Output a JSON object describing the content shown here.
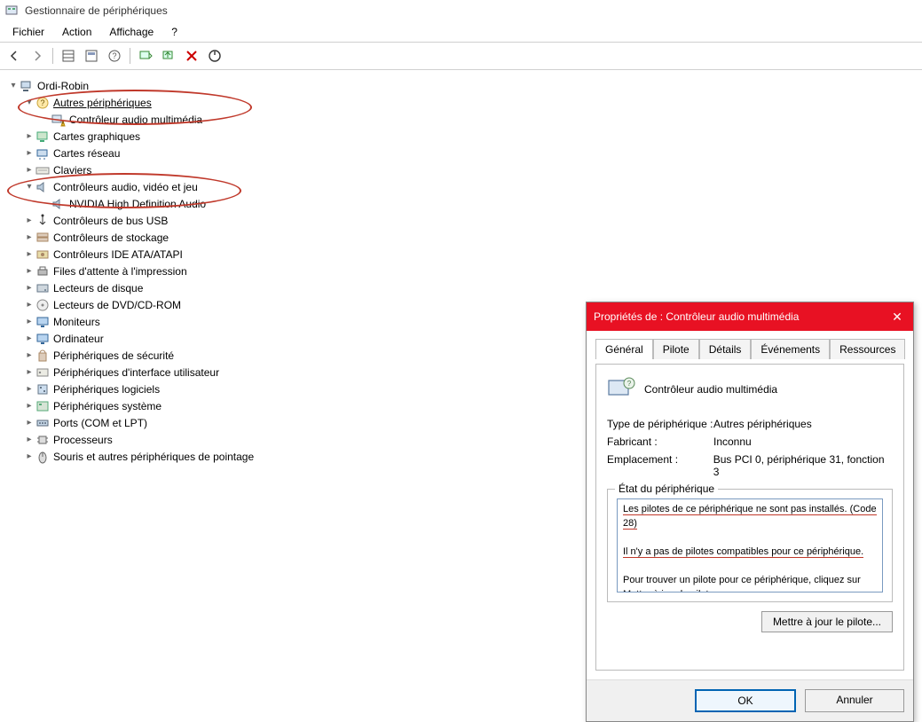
{
  "window_title": "Gestionnaire de périphériques",
  "menu": {
    "file": "Fichier",
    "action": "Action",
    "view": "Affichage",
    "help": "?"
  },
  "tree": {
    "root": "Ordi-Robin",
    "other_devices": "Autres périphériques",
    "mm_audio_controller": "Contrôleur audio multimédia",
    "graphics": "Cartes graphiques",
    "network": "Cartes réseau",
    "keyboards": "Claviers",
    "avj": "Contrôleurs audio, vidéo et jeu",
    "nvidia_hd": "NVIDIA High Definition Audio",
    "usb": "Contrôleurs de bus USB",
    "storage": "Contrôleurs de stockage",
    "ide": "Contrôleurs IDE ATA/ATAPI",
    "print_queue": "Files d'attente à l'impression",
    "disk": "Lecteurs de disque",
    "dvd": "Lecteurs de DVD/CD-ROM",
    "monitors": "Moniteurs",
    "computer": "Ordinateur",
    "security": "Périphériques de sécurité",
    "hid": "Périphériques d'interface utilisateur",
    "software": "Périphériques logiciels",
    "system": "Périphériques système",
    "ports": "Ports (COM et LPT)",
    "cpu": "Processeurs",
    "mice": "Souris et autres périphériques de pointage"
  },
  "dialog": {
    "title": "Propriétés de : Contrôleur audio multimédia",
    "tabs": {
      "general": "Général",
      "driver": "Pilote",
      "details": "Détails",
      "events": "Événements",
      "resources": "Ressources"
    },
    "device_name": "Contrôleur audio multimédia",
    "kv": {
      "type_label": "Type de périphérique :",
      "type_value": "Autres périphériques",
      "vendor_label": "Fabricant :",
      "vendor_value": "Inconnu",
      "location_label": "Emplacement :",
      "location_value": "Bus PCI 0, périphérique 31, fonction 3"
    },
    "status_legend": "État du périphérique",
    "status1": "Les pilotes de ce périphérique ne sont pas installés. (Code 28)",
    "status2": "Il n'y a pas de pilotes compatibles pour ce périphérique.",
    "status3": "Pour trouver un pilote pour ce périphérique, cliquez sur Mettre à jour le pilote.",
    "update_btn": "Mettre à jour le pilote...",
    "ok": "OK",
    "cancel": "Annuler"
  }
}
